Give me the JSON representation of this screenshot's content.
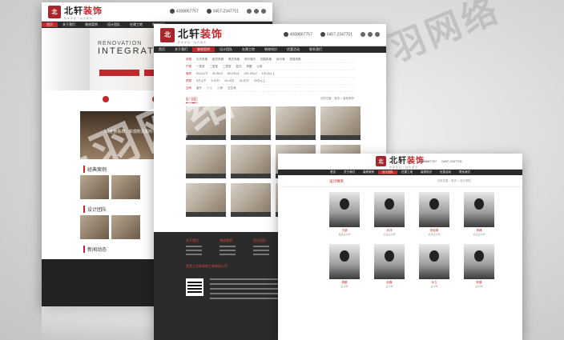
{
  "brand": {
    "name_black": "北轩",
    "name_red": "装饰",
    "logo_mark": "北",
    "tagline": "整体家装一站式服务"
  },
  "contact": {
    "phone": "4008867757",
    "hotline": "0457-2347701"
  },
  "nav_items": [
    "首页",
    "关于我们",
    "装修案例",
    "设计团队",
    "在建工地",
    "装修知识",
    "优惠活动",
    "联系我们"
  ],
  "left_page": {
    "hero_line1": "RENOVATION",
    "hero_line2": "INTEGRATED",
    "room_caption": "3D全景看样 · 实现所见即所得",
    "section_cases": "经典案例",
    "section_designers": "设计团队",
    "section_news": "新闻动态"
  },
  "middle_page": {
    "filters": [
      {
        "label": "风格",
        "items": [
          "中式风格",
          "欧式风格",
          "美式风格",
          "现代简约",
          "田园风格",
          "地中海",
          "混搭风格"
        ]
      },
      {
        "label": "户型",
        "items": [
          "一居室",
          "二居室",
          "三居室",
          "复式",
          "别墅",
          "公寓"
        ]
      },
      {
        "label": "面积",
        "items": [
          "60㎡以下",
          "60-80㎡",
          "80-100㎡",
          "100-120㎡",
          "120㎡以上"
        ]
      },
      {
        "label": "预算",
        "items": [
          "5万以下",
          "5-10万",
          "10-15万",
          "15-20万",
          "20万以上"
        ]
      },
      {
        "label": "空间",
        "items": [
          "客厅",
          "卧室",
          "厨房",
          "卫生间"
        ]
      }
    ],
    "section_title": "效果图",
    "breadcrumb": "当前位置：首页 > 装修案例",
    "footer_cols": [
      "关于我们",
      "装修案例",
      "设计团队",
      "装修知识",
      "联系我们"
    ],
    "footer_company": "黑龙江北轩装饰工程有限公司"
  },
  "right_page": {
    "section_title": "设计精英",
    "breadcrumb": "当前位置：首页 > 设计团队",
    "designers": [
      {
        "name": "王超",
        "role": "首席设计师"
      },
      {
        "name": "刘洋",
        "role": "主任设计师"
      },
      {
        "name": "张晓燕",
        "role": "资深设计师"
      },
      {
        "name": "李峰",
        "role": "资深设计师"
      },
      {
        "name": "周鹏",
        "role": "设计师"
      },
      {
        "name": "赵磊",
        "role": "设计师"
      },
      {
        "name": "孙立",
        "role": "设计师"
      },
      {
        "name": "陈晨",
        "role": "设计师"
      }
    ]
  },
  "watermark_main": "千羽网络",
  "watermark_side": "羽网络"
}
